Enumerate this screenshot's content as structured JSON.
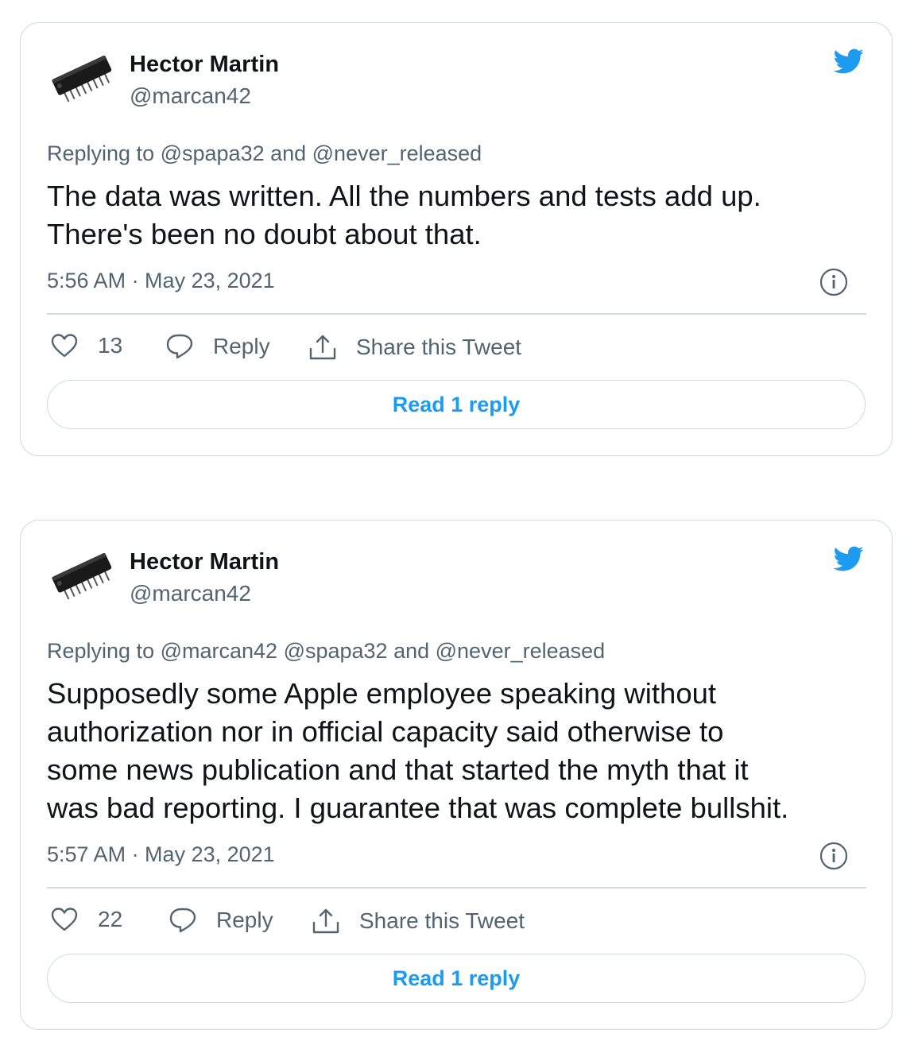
{
  "tweets": [
    {
      "author_name": "Hector Martin",
      "author_handle": "@marcan42",
      "replying_prefix": "Replying to ",
      "replying_to": "@spapa32 and @never_released",
      "body_lines": [
        "The data was written. All the numbers and tests add up.",
        "There's been no doubt about that."
      ],
      "timestamp": "5:56 AM · May 23, 2021",
      "likes": "13",
      "reply_label": "Reply",
      "share_label": "Share this Tweet",
      "read_replies_label": "Read 1 reply"
    },
    {
      "author_name": "Hector Martin",
      "author_handle": "@marcan42",
      "replying_prefix": "Replying to ",
      "replying_to": "@marcan42 @spapa32 and @never_released",
      "body_lines": [
        "Supposedly some Apple employee speaking without",
        "authorization nor in official capacity said otherwise to",
        "some news publication and that started the myth that it",
        "was bad reporting. I guarantee that was complete bullshit."
      ],
      "timestamp": "5:57 AM · May 23, 2021",
      "likes": "22",
      "reply_label": "Reply",
      "share_label": "Share this Tweet",
      "read_replies_label": "Read 1 reply"
    }
  ],
  "colors": {
    "twitter_blue": "#1d9bf0",
    "muted_text": "#536471",
    "border": "#cfd9de"
  },
  "icons": {
    "avatar": "ic-chip-avatar",
    "brand": "twitter-bird-icon",
    "like": "heart-icon",
    "reply": "speech-bubble-icon",
    "share": "share-upload-icon",
    "info": "info-icon"
  }
}
